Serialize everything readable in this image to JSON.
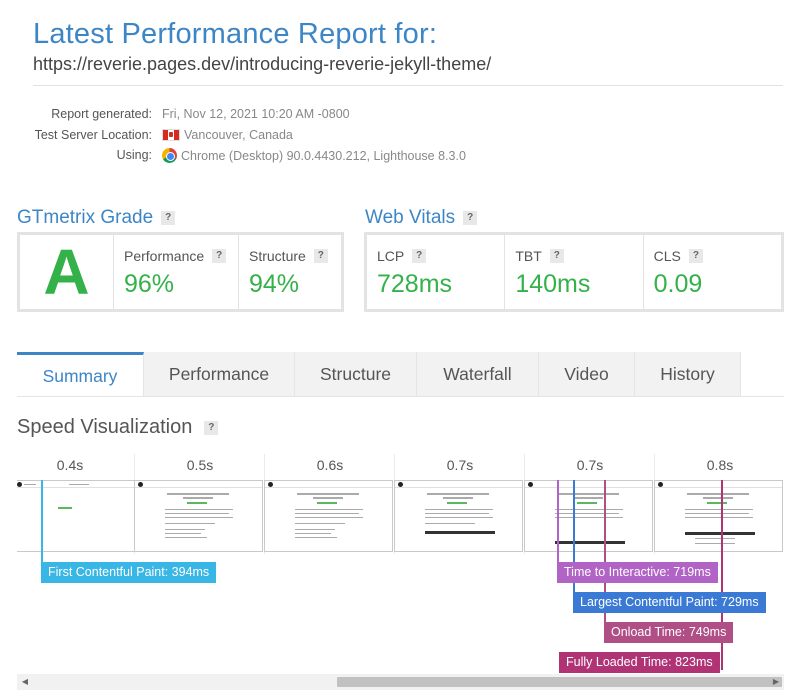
{
  "header": {
    "title": "Latest Performance Report for:",
    "url": "https://reverie.pages.dev/introducing-reverie-jekyll-theme/"
  },
  "meta": {
    "generated_label": "Report generated:",
    "generated_value": "Fri, Nov 12, 2021 10:20 AM -0800",
    "location_label": "Test Server Location:",
    "location_value": "Vancouver, Canada",
    "using_label": "Using:",
    "using_value": "Chrome (Desktop) 90.0.4430.212, Lighthouse 8.3.0"
  },
  "grade": {
    "heading": "GTmetrix Grade",
    "letter": "A",
    "performance_label": "Performance",
    "performance_value": "96%",
    "structure_label": "Structure",
    "structure_value": "94%"
  },
  "vitals": {
    "heading": "Web Vitals",
    "lcp_label": "LCP",
    "lcp_value": "728ms",
    "tbt_label": "TBT",
    "tbt_value": "140ms",
    "cls_label": "CLS",
    "cls_value": "0.09"
  },
  "help_glyph": "?",
  "tabs": [
    "Summary",
    "Performance",
    "Structure",
    "Waterfall",
    "Video",
    "History"
  ],
  "speed": {
    "heading": "Speed Visualization",
    "frames": [
      "0.4s",
      "0.5s",
      "0.6s",
      "0.7s",
      "0.7s",
      "0.8s"
    ],
    "markers": {
      "fcp": "First Contentful Paint: 394ms",
      "tti": "Time to Interactive: 719ms",
      "lcp": "Largest Contentful Paint: 729ms",
      "onload": "Onload Time: 749ms",
      "fully": "Fully Loaded Time: 823ms"
    }
  },
  "colors": {
    "accent": "#3d86c6",
    "grade_green": "#35b14a",
    "fcp": "#38b6e6",
    "tti": "#b164c6",
    "lcp": "#3a7ad4",
    "onload": "#b04e86",
    "fully": "#b03375"
  },
  "icons": {
    "flag": "canada-flag-icon",
    "browser": "chrome-icon",
    "scroll_left": "arrow-left-icon",
    "scroll_right": "arrow-right-icon"
  }
}
